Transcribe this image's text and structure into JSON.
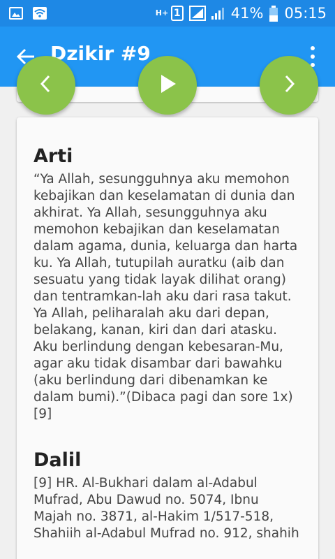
{
  "status_bar": {
    "battery": "41%",
    "time": "05:15",
    "sim": "1",
    "network_type": "H+"
  },
  "app_bar": {
    "title": "Dzikir #9"
  },
  "colors": {
    "status_bar": "#1e88e5",
    "app_bar": "#2196f3",
    "fab": "#8bc34a"
  },
  "controls": {
    "prev_icon": "chevron-left-icon",
    "play_icon": "play-icon",
    "next_icon": "chevron-right-icon"
  },
  "content": {
    "arti_title": "Arti",
    "arti_text": "“Ya Allah, sesungguhnya aku memohon kebajikan dan keselamatan di dunia dan akhirat. Ya Allah, sesungguhnya aku memohon kebajikan dan keselamatan dalam agama, dunia, keluarga dan harta ku. Ya Allah, tutupilah auratku (aib dan sesuatu yang tidak layak dilihat orang) dan tentramkan-lah aku dari rasa takut. Ya Allah, peliharalah aku dari depan, belakang, kanan, kiri dan dari atasku. Aku berlindung dengan kebesaran-Mu, agar aku tidak disambar dari bawahku (aku berlindung dari dibenamkan ke dalam bumi).”(Dibaca pagi dan sore 1x) [9]",
    "dalil_title": "Dalil",
    "dalil_text": "[9] HR. Al-Bukhari dalam al-Adabul Mufrad, Abu Dawud no. 5074, Ibnu Majah no. 3871, al-Hakim 1/517-518, Shahiih al-Adabul Mufrad no. 912, shahih"
  }
}
